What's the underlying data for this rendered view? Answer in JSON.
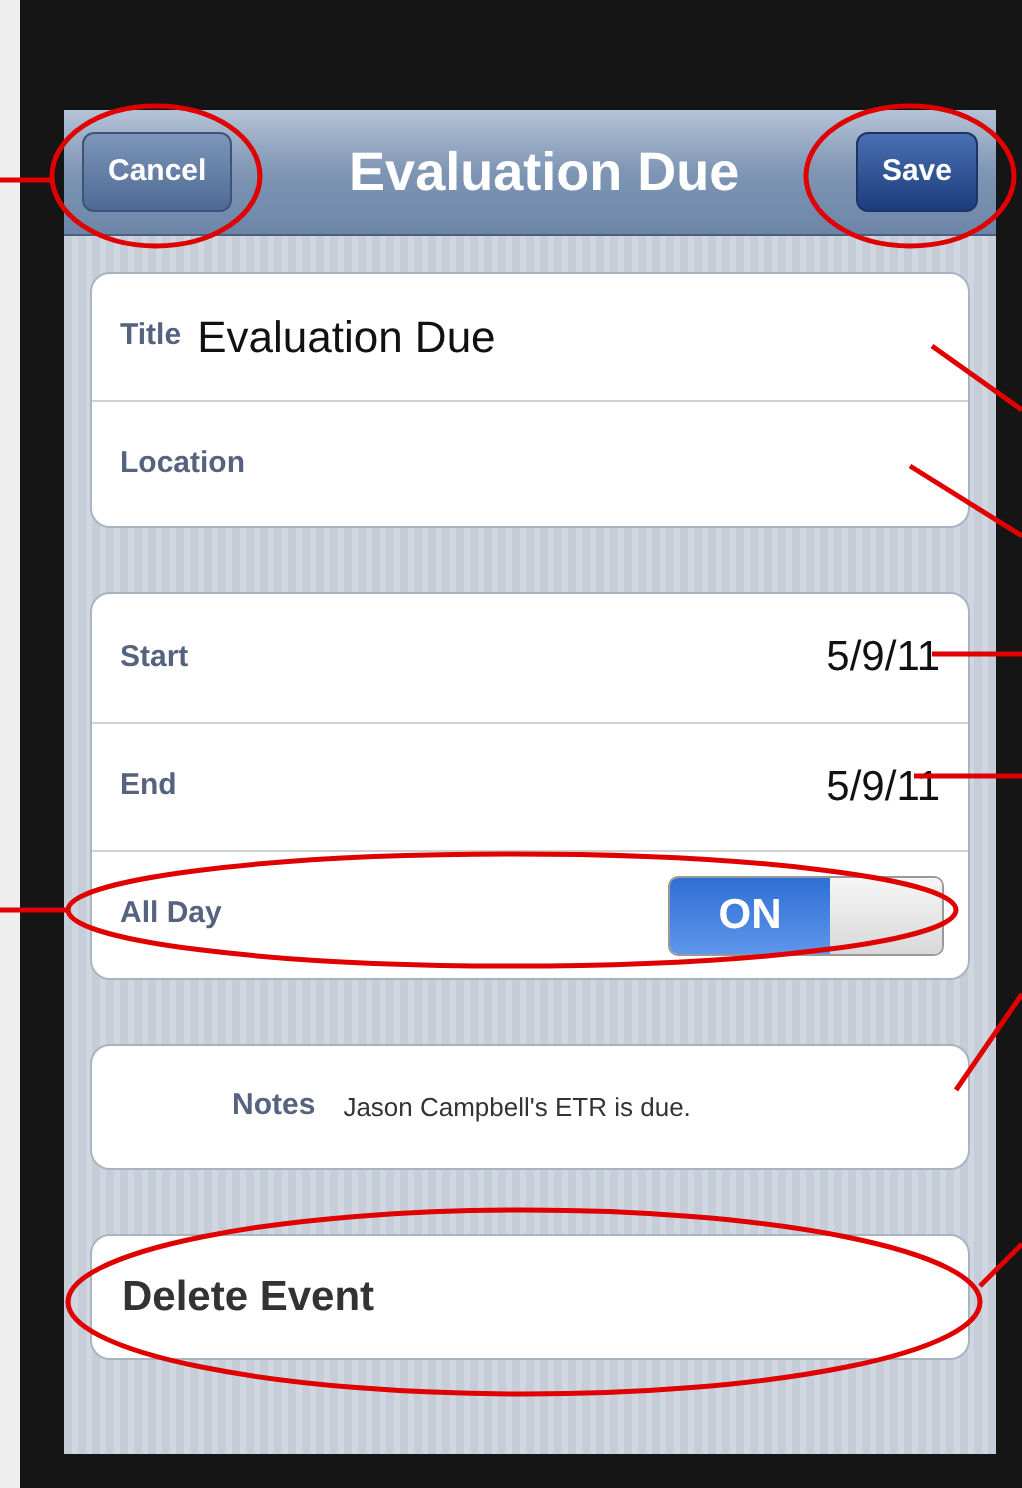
{
  "nav_bar": {
    "cancel": "Cancel",
    "title": "Evaluation Due",
    "save": "Save"
  },
  "event_fields": [
    {
      "label": "Title",
      "value": "Evaluation Due"
    },
    {
      "label": "Location"
    }
  ],
  "date_fields": [
    {
      "label": "Start",
      "value": "5/9/11"
    },
    {
      "label": "End",
      "value": "5/9/11"
    }
  ],
  "all_day": {
    "label": "All Day",
    "on": true,
    "state_text": "ON"
  },
  "notes": {
    "label": "Notes",
    "value": "Jason Campbell's ETR is due."
  },
  "delete_button": "Delete Event"
}
